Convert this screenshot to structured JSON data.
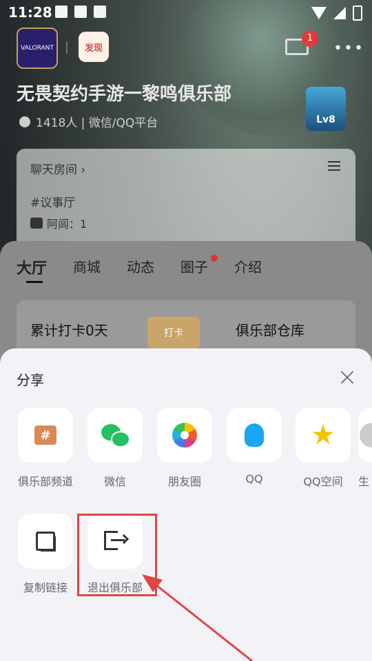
{
  "status_bar": {
    "time": "11:28"
  },
  "header": {
    "club_logo_text": "VALORANT",
    "discover_label": "发现",
    "mail_badge": "1",
    "more_label": "•••"
  },
  "club": {
    "title": "无畏契约手游一黎鸣俱乐部",
    "meta": "1418人 | 微信/QQ平台",
    "level": "Lv8"
  },
  "chat_card": {
    "title": "聊天房间",
    "chevron": "›",
    "channel": "#议事厅",
    "sub": "阿闾：1"
  },
  "tabs": [
    {
      "label": "大厅",
      "active": true
    },
    {
      "label": "商城"
    },
    {
      "label": "动态"
    },
    {
      "label": "圈子",
      "badge": true
    },
    {
      "label": "介绍"
    }
  ],
  "checkin_card": {
    "left_text": "累计打卡0天",
    "button_text": "打卡",
    "right_text": "俱乐部仓库"
  },
  "share_sheet": {
    "title": "分享",
    "row1": [
      {
        "label": "俱乐部频道",
        "icon": "club-channel-icon"
      },
      {
        "label": "微信",
        "icon": "wechat-icon"
      },
      {
        "label": "朋友圈",
        "icon": "moments-icon"
      },
      {
        "label": "QQ",
        "icon": "qq-icon"
      },
      {
        "label": "QQ空间",
        "icon": "qzone-icon"
      },
      {
        "label": "生",
        "icon": "partial-icon"
      }
    ],
    "row2": [
      {
        "label": "复制链接",
        "icon": "copy-link-icon"
      },
      {
        "label": "退出俱乐部",
        "icon": "exit-icon"
      }
    ]
  },
  "annotation": {
    "color": "#e24444"
  }
}
